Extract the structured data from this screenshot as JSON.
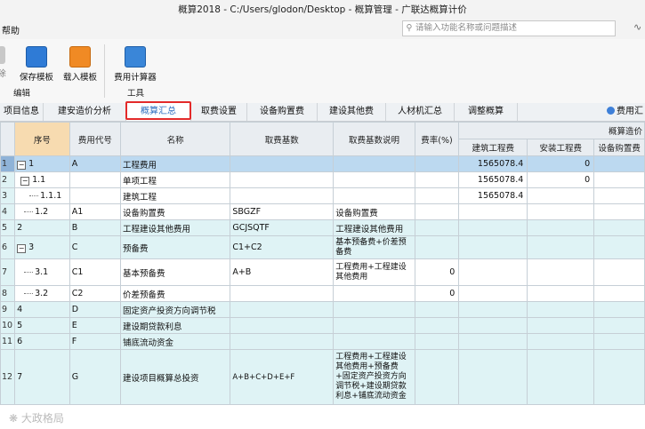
{
  "window": {
    "title": "概算2018 - C:/Users/glodon/Desktop - 概算管理 - 广联达概算计价",
    "menu_help": "帮助",
    "top_right_icon": "cloud-icon"
  },
  "search": {
    "placeholder": "请输入功能名称或问题描述",
    "icon": "search-icon"
  },
  "ribbon": {
    "buttons": [
      {
        "label": "保存模板",
        "icon": "save-template-icon"
      },
      {
        "label": "载入模板",
        "icon": "load-template-icon"
      },
      {
        "label": "费用计算器",
        "icon": "calculator-icon"
      }
    ],
    "groups": {
      "edit": "编辑",
      "tools": "工具"
    },
    "left_cut": "除"
  },
  "tabs": [
    {
      "label": "项目信息"
    },
    {
      "label": "建安造价分析"
    },
    {
      "label": "概算汇总"
    },
    {
      "label": "取费设置"
    },
    {
      "label": "设备购置费"
    },
    {
      "label": "建设其他费"
    },
    {
      "label": "人材机汇总"
    },
    {
      "label": "调整概算"
    }
  ],
  "tab_right": "费用汇",
  "table": {
    "headers": {
      "seq": "序号",
      "code": "费用代号",
      "name": "名称",
      "base": "取费基数",
      "base_desc": "取费基数说明",
      "rate": "费率(%)",
      "group": "概算造价",
      "c1": "建筑工程费",
      "c2": "安装工程费",
      "c3": "设备购置费"
    },
    "rows": [
      {
        "rn": "1",
        "seq": "1",
        "code": "A",
        "name": "工程费用",
        "base": "",
        "desc": "",
        "rate": "",
        "c1": "1565078.4",
        "c2": "0",
        "c3": ""
      },
      {
        "rn": "2",
        "seq": "1.1",
        "code": "",
        "name": "单项工程",
        "base": "",
        "desc": "",
        "rate": "",
        "c1": "1565078.4",
        "c2": "0",
        "c3": ""
      },
      {
        "rn": "3",
        "seq": "1.1.1",
        "code": "",
        "name": "建筑工程",
        "base": "",
        "desc": "",
        "rate": "",
        "c1": "1565078.4",
        "c2": "",
        "c3": ""
      },
      {
        "rn": "4",
        "seq": "1.2",
        "code": "A1",
        "name": "设备购置费",
        "base": "SBGZF",
        "desc": "设备购置费",
        "rate": "",
        "c1": "",
        "c2": "",
        "c3": ""
      },
      {
        "rn": "5",
        "seq": "2",
        "code": "B",
        "name": "工程建设其他费用",
        "base": "GCJSQTF",
        "desc": "工程建设其他费用",
        "rate": "",
        "c1": "",
        "c2": "",
        "c3": ""
      },
      {
        "rn": "6",
        "seq": "3",
        "code": "C",
        "name": "预备费",
        "base": "C1+C2",
        "desc": "基本预备费+价差预备费",
        "rate": "",
        "c1": "",
        "c2": "",
        "c3": ""
      },
      {
        "rn": "7",
        "seq": "3.1",
        "code": "C1",
        "name": "基本预备费",
        "base": "A+B",
        "desc": "工程费用+工程建设其他费用",
        "rate": "0",
        "c1": "",
        "c2": "",
        "c3": ""
      },
      {
        "rn": "8",
        "seq": "3.2",
        "code": "C2",
        "name": "价差预备费",
        "base": "",
        "desc": "",
        "rate": "0",
        "c1": "",
        "c2": "",
        "c3": ""
      },
      {
        "rn": "9",
        "seq": "4",
        "code": "D",
        "name": "固定资产投资方向调节税",
        "base": "",
        "desc": "",
        "rate": "",
        "c1": "",
        "c2": "",
        "c3": ""
      },
      {
        "rn": "10",
        "seq": "5",
        "code": "E",
        "name": "建设期贷款利息",
        "base": "",
        "desc": "",
        "rate": "",
        "c1": "",
        "c2": "",
        "c3": ""
      },
      {
        "rn": "11",
        "seq": "6",
        "code": "F",
        "name": "铺底流动资金",
        "base": "",
        "desc": "",
        "rate": "",
        "c1": "",
        "c2": "",
        "c3": ""
      },
      {
        "rn": "12",
        "seq": "7",
        "code": "G",
        "name": "建设项目概算总投资",
        "base": "A+B+C+D+E+F",
        "desc": "工程费用+工程建设其他费用+预备费+固定资产投资方向调节税+建设期贷款利息+铺底流动资金",
        "rate": "",
        "c1": "",
        "c2": "",
        "c3": ""
      }
    ]
  },
  "watermark": "大政格局"
}
